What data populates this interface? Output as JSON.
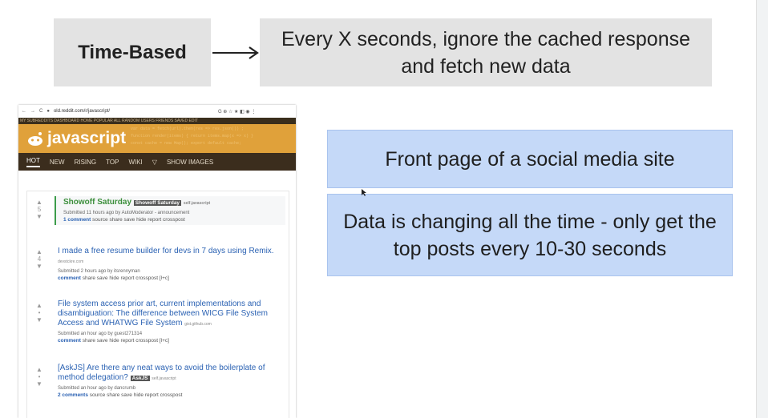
{
  "header": {
    "label": "Time-Based",
    "description": "Every X seconds, ignore the cached response and fetch new data"
  },
  "callouts": {
    "example": "Front page of a social media site",
    "explanation": "Data is changing all the time - only get the top posts every 10-30 seconds"
  },
  "browser": {
    "url": "old.reddit.com/r/javascript/",
    "subreddit_bar": "MY SUBREDDITS  DASHBOARD  HOME  POPULAR  ALL  RANDOM  USERS  FRIENDS  SAVED  EDIT",
    "subreddit_name": "javascript",
    "tabs": [
      "HOT",
      "NEW",
      "RISING",
      "TOP",
      "WIKI",
      "SHOW IMAGES"
    ],
    "posts": [
      {
        "title": "Showoff Saturday",
        "flair": "Showoff Saturday",
        "domain": "self.javascript",
        "score": "5",
        "meta": "Submitted 11 hours ago by AutoModerator - announcement",
        "links": [
          "1 comment",
          "source",
          "share",
          "save",
          "hide",
          "report",
          "crosspost"
        ]
      },
      {
        "title": "I made a free resume builder for devs in 7 days using Remix.",
        "domain": "devstckre.com",
        "score": "4",
        "meta": "Submitted 2 hours ago by itsrennyman",
        "links": [
          "comment",
          "share",
          "save",
          "hide",
          "report",
          "crosspost",
          "[l+c]"
        ]
      },
      {
        "title": "File system access prior art, current implementations and disambiguation: The difference between WICG File System Access and WHATWG File System",
        "domain": "gist.github.com",
        "score": "•",
        "meta": "Submitted an hour ago by guest271314",
        "links": [
          "comment",
          "share",
          "save",
          "hide",
          "report",
          "crosspost",
          "[l+c]"
        ]
      },
      {
        "title": "[AskJS] Are there any neat ways to avoid the boilerplate of method delegation?",
        "flair": "AskJS",
        "domain": "self.javascript",
        "score": "•",
        "meta": "Submitted an hour ago by dancrumb",
        "links": [
          "2 comments",
          "source",
          "share",
          "save",
          "hide",
          "report",
          "crosspost"
        ]
      }
    ]
  }
}
